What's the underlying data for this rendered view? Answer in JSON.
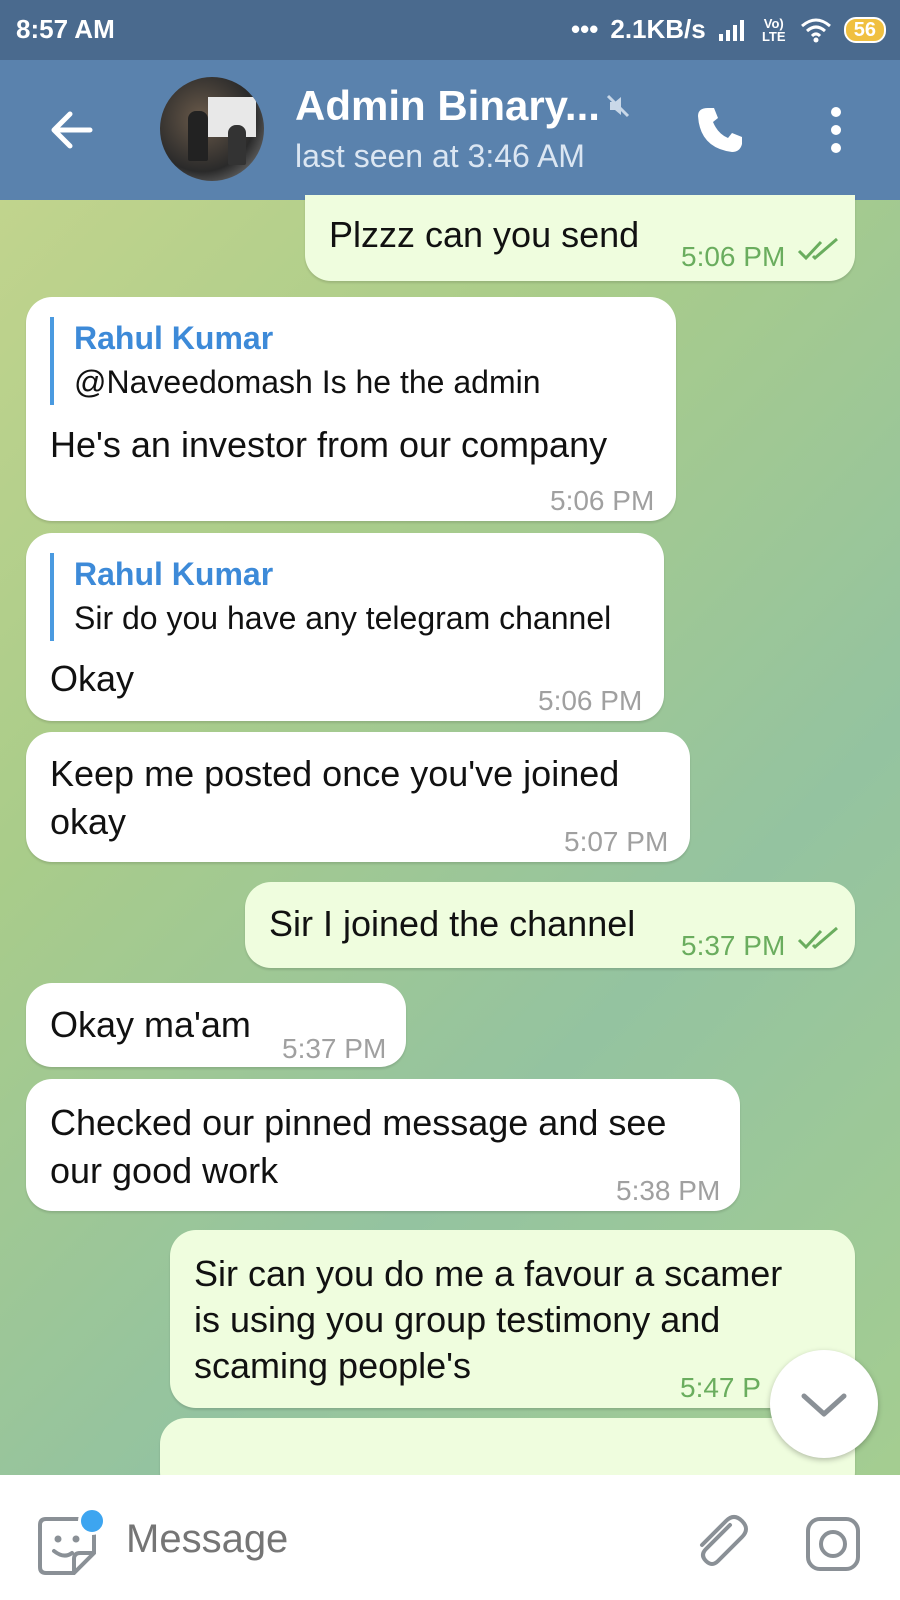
{
  "status": {
    "time": "8:57 AM",
    "net_speed": "2.1KB/s",
    "volte": "Vo) LTE",
    "battery": "56"
  },
  "header": {
    "name": "Admin Binary...",
    "last_seen": "last seen at 3:46 AM"
  },
  "messages": [
    {
      "direction": "out",
      "text": "Plzzz can you send",
      "time": "5:06 PM",
      "read": true
    },
    {
      "direction": "in",
      "reply_name": "Rahul Kumar",
      "reply_text": "@Naveedomash  Is he the admin",
      "text": "He's an investor from our company",
      "time": "5:06 PM"
    },
    {
      "direction": "in",
      "reply_name": "Rahul Kumar",
      "reply_text": "Sir do you have any telegram channel",
      "text": "Okay",
      "time": "5:06 PM"
    },
    {
      "direction": "in",
      "text": "Keep me posted once you've joined okay",
      "line1": "Keep me posted once you've joined",
      "line2": "okay",
      "time": "5:07 PM"
    },
    {
      "direction": "out",
      "text": "Sir I joined the channel",
      "time": "5:37 PM",
      "read": true
    },
    {
      "direction": "in",
      "text": "Okay ma'am",
      "time": "5:37 PM"
    },
    {
      "direction": "in",
      "text": "Checked our pinned message and see our good work",
      "line1": "Checked our pinned message and see",
      "line2": "our good work",
      "time": "5:38 PM"
    },
    {
      "direction": "out",
      "text": "Sir can you do me a favour a scamer is using you group testimony and scaming people's",
      "line1": "Sir can you do me a favour a scamer",
      "line2": "is using you group testimony and",
      "line3": "scaming people's",
      "time": "5:47 P"
    }
  ],
  "composer": {
    "placeholder": "Message"
  },
  "colors": {
    "header": "#5a82ad",
    "status_bar": "#4a6a8e",
    "outgoing_bubble": "#effdde",
    "incoming_bubble": "#ffffff",
    "reply_name": "#3d8ad8",
    "outgoing_time": "#6aad5e"
  },
  "icons": [
    "back-arrow-icon",
    "mute-icon",
    "phone-icon",
    "more-vert-icon",
    "read-ticks-icon",
    "chevron-down-icon",
    "sticker-icon",
    "paperclip-icon",
    "camera-icon"
  ]
}
